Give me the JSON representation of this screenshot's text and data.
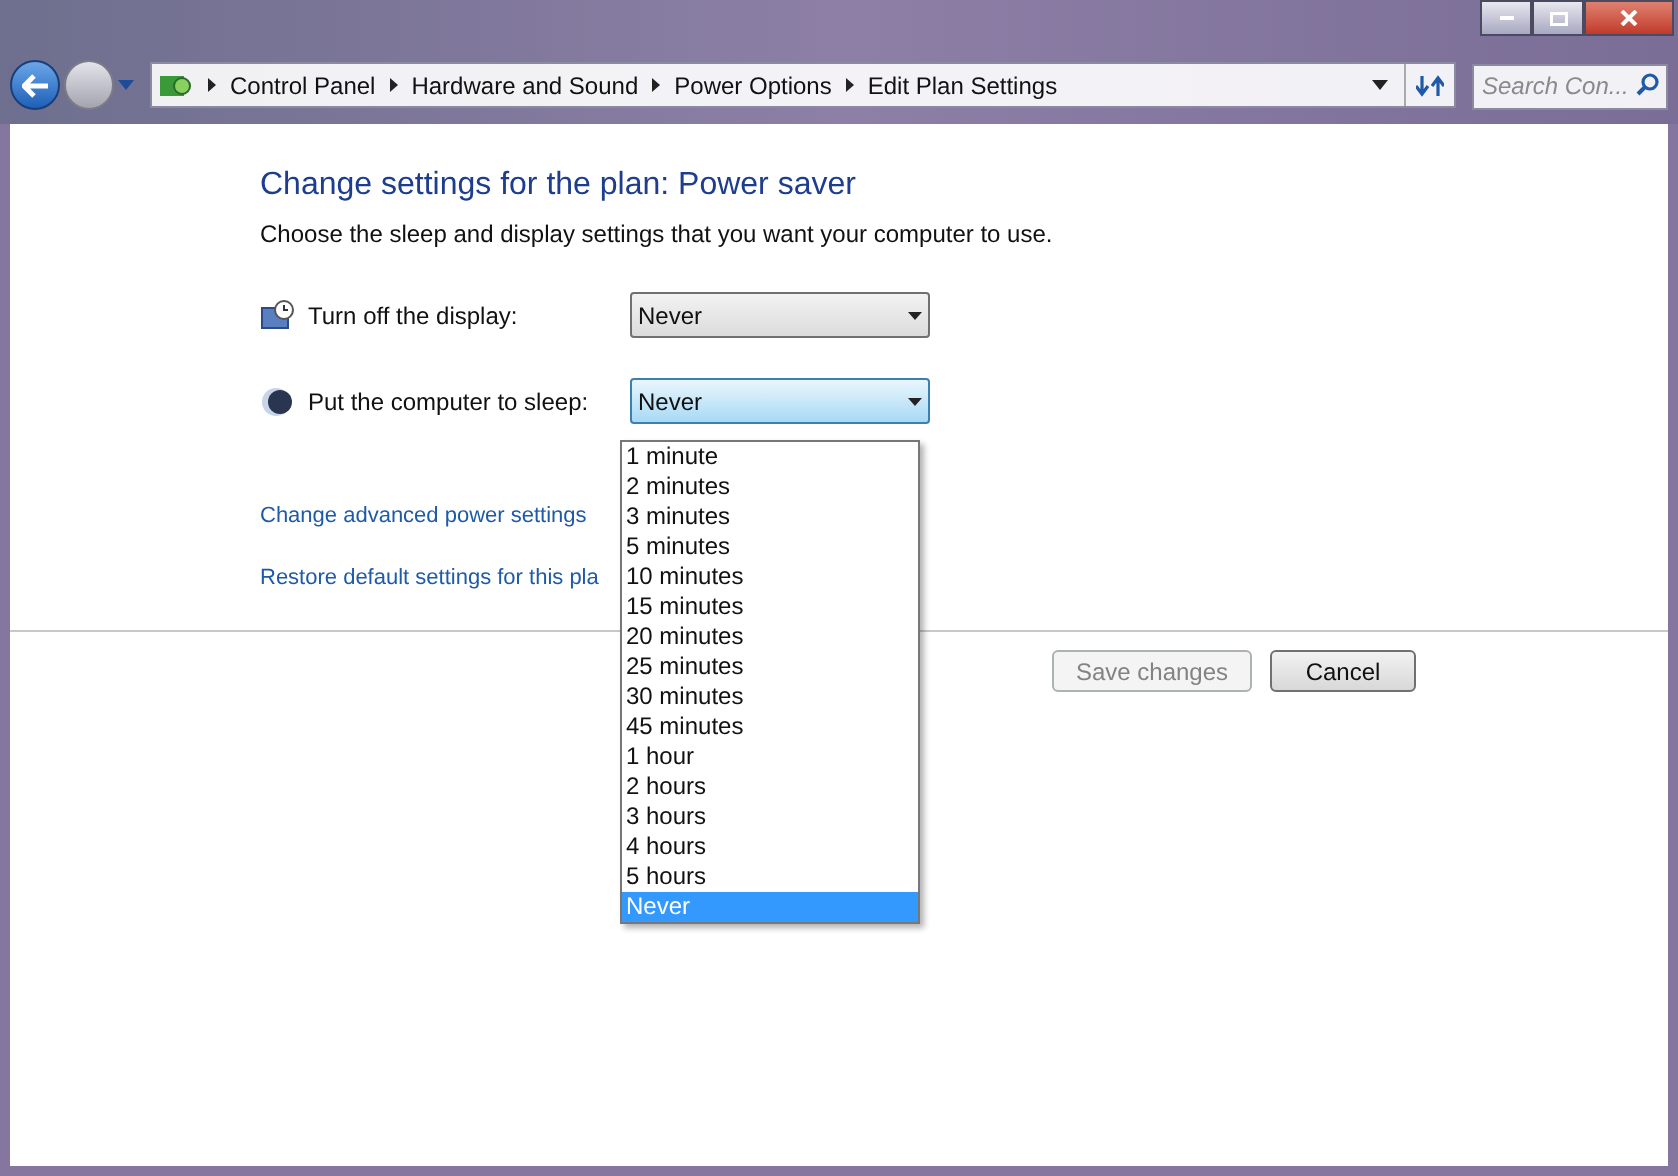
{
  "address_bar": {
    "breadcrumbs": [
      "Control Panel",
      "Hardware and Sound",
      "Power Options",
      "Edit Plan Settings"
    ]
  },
  "search": {
    "placeholder": "Search Con..."
  },
  "heading": "Change settings for the plan: Power saver",
  "description": "Choose the sleep and display settings that you want your computer to use.",
  "settings": [
    {
      "kind": "display",
      "label": "Turn off the display:",
      "value": "Never",
      "expanded": false
    },
    {
      "kind": "sleep",
      "label": "Put the computer to sleep:",
      "value": "Never",
      "expanded": true
    }
  ],
  "links": [
    "Change advanced power settings",
    "Restore default settings for this pla"
  ],
  "dropdown_options": [
    {
      "label": "1 minute",
      "selected": false
    },
    {
      "label": "2 minutes",
      "selected": false
    },
    {
      "label": "3 minutes",
      "selected": false
    },
    {
      "label": "5 minutes",
      "selected": false
    },
    {
      "label": "10 minutes",
      "selected": false
    },
    {
      "label": "15 minutes",
      "selected": false
    },
    {
      "label": "20 minutes",
      "selected": false
    },
    {
      "label": "25 minutes",
      "selected": false
    },
    {
      "label": "30 minutes",
      "selected": false
    },
    {
      "label": "45 minutes",
      "selected": false
    },
    {
      "label": "1 hour",
      "selected": false
    },
    {
      "label": "2 hours",
      "selected": false
    },
    {
      "label": "3 hours",
      "selected": false
    },
    {
      "label": "4 hours",
      "selected": false
    },
    {
      "label": "5 hours",
      "selected": false
    },
    {
      "label": "Never",
      "selected": true
    }
  ],
  "buttons": [
    {
      "label": "Save changes",
      "disabled": true
    },
    {
      "label": "Cancel",
      "disabled": false
    }
  ]
}
